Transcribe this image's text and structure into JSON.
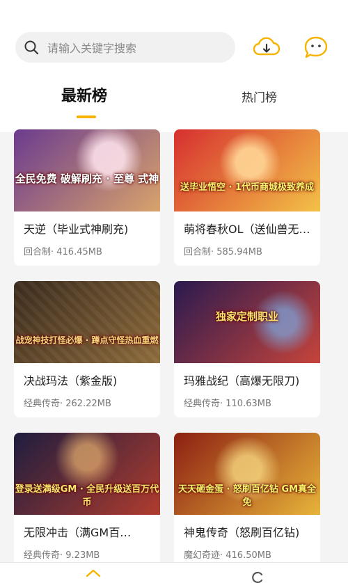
{
  "search": {
    "placeholder": "请输入关键字搜索",
    "icon": "search-icon"
  },
  "header_actions": [
    {
      "name": "download-cloud-icon",
      "icon": "download-cloud"
    },
    {
      "name": "message-bubble-icon",
      "icon": "chat-bubble"
    }
  ],
  "tabs": [
    {
      "label": "最新榜",
      "active": true
    },
    {
      "label": "热门榜",
      "active": false
    }
  ],
  "accent_color": "#f6b400",
  "games": [
    {
      "title": "天逆（毕业式神刷充)",
      "meta": "回合制· 416.45MB",
      "art_text": "全民免费 破解刷充 · 至尊 式神",
      "colors": [
        "#6b3b8f",
        "#d9a36b"
      ]
    },
    {
      "title": "萌将春秋OL（送仙兽无…",
      "meta": "回合制· 585.94MB",
      "art_text": "送毕业悟空 · 1代币商城极致养成",
      "colors": [
        "#d62f2f",
        "#f3c247"
      ]
    },
    {
      "title": "决战玛法（紫金版)",
      "meta": "经典传奇· 262.22MB",
      "art_text": "战宠神技打怪必爆 · 蹲点守怪热血重燃",
      "colors": [
        "#3a2a1c",
        "#8c6a3a"
      ]
    },
    {
      "title": "玛雅战纪（高爆无限刀)",
      "meta": "经典传奇· 110.63MB",
      "art_text": "独家定制职业",
      "colors": [
        "#2a1a4f",
        "#c6443b"
      ]
    },
    {
      "title": "无限冲击（满GM百…",
      "meta": "经典传奇· 9.23MB",
      "art_text": "登录送满级GM · 全民升级送百万代币",
      "colors": [
        "#1e1d3f",
        "#b03c2e"
      ]
    },
    {
      "title": "神鬼传奇（怒刷百亿钻)",
      "meta": "魔幻奇迹· 416.50MB",
      "art_text": "天天砸金蛋 · 怒刷百亿钻 GM真全免",
      "colors": [
        "#8c1f12",
        "#e7b43a"
      ]
    }
  ],
  "bottom_nav": [
    {
      "name": "home-icon"
    },
    {
      "name": "refresh-icon"
    }
  ]
}
